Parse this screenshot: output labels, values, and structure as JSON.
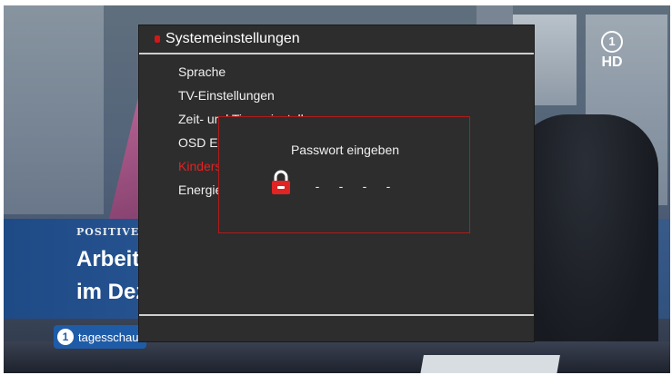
{
  "tv": {
    "top_caption": "",
    "lower_third_tag": "POSITIVE",
    "headline_line1": "Arbeitsmarkt",
    "headline_line2": "im Dezember",
    "channel_logo_text": "tagesschau",
    "channel_logo_number": "1",
    "channel_badge_number": "1",
    "channel_badge_text": "HD"
  },
  "osd": {
    "title": "Systemeinstellungen",
    "menu_items": [
      {
        "label": "Sprache",
        "active": false
      },
      {
        "label": "TV-Einstellungen",
        "active": false
      },
      {
        "label": "Zeit- und Timereinstellungen",
        "active": false
      },
      {
        "label": "OSD Einstellungen",
        "active": false
      },
      {
        "label": "Kindersicherung",
        "active": true
      },
      {
        "label": "Energieeinstellungen",
        "active": false
      }
    ]
  },
  "dialog": {
    "prompt": "Passwort eingeben",
    "pin_digits": [
      "-",
      "-",
      "-",
      "-"
    ]
  },
  "colors": {
    "accent_red": "#e02424",
    "dialog_border": "#b21a1a",
    "osd_background": "#2d2d2d",
    "lower_third_blue": "#1f5ca8"
  },
  "icons": {
    "menu_bullet": "red-bullet-icon",
    "lock": "padlock-icon",
    "channel": "das-erste-logo-icon"
  }
}
